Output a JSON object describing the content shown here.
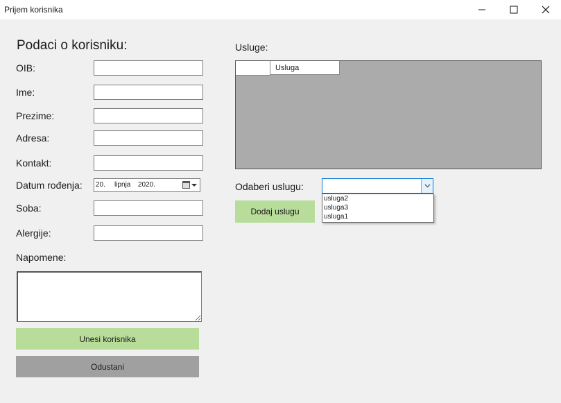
{
  "window": {
    "title": "Prijem korisnika"
  },
  "user_section": {
    "heading": "Podaci o korisniku:",
    "fields": {
      "oib": {
        "label": "OIB:",
        "value": ""
      },
      "ime": {
        "label": "Ime:",
        "value": ""
      },
      "prezime": {
        "label": "Prezime:",
        "value": ""
      },
      "adresa": {
        "label": "Adresa:",
        "value": ""
      },
      "kontakt": {
        "label": "Kontakt:",
        "value": ""
      },
      "datum": {
        "label": "Datum rođenja:",
        "day": "20.",
        "month": "lipnja",
        "year": "2020."
      },
      "soba": {
        "label": "Soba:",
        "value": ""
      },
      "alergije": {
        "label": "Alergije:",
        "value": ""
      }
    },
    "notes": {
      "label": "Napomene:",
      "value": ""
    },
    "submit_label": "Unesi korisnika",
    "cancel_label": "Odustani"
  },
  "services_section": {
    "label": "Usluge:",
    "grid_columns": [
      "Usluga"
    ],
    "choose_label": "Odaberi uslugu:",
    "combo_value": "",
    "options": [
      "usluga2",
      "usluga3",
      "usluga1"
    ],
    "add_label": "Dodaj uslugu"
  },
  "colors": {
    "primary_button": "#b8dc9a",
    "cancel_button": "#a0a0a0",
    "grid_background": "#ababab",
    "focus_border": "#0078d7"
  }
}
